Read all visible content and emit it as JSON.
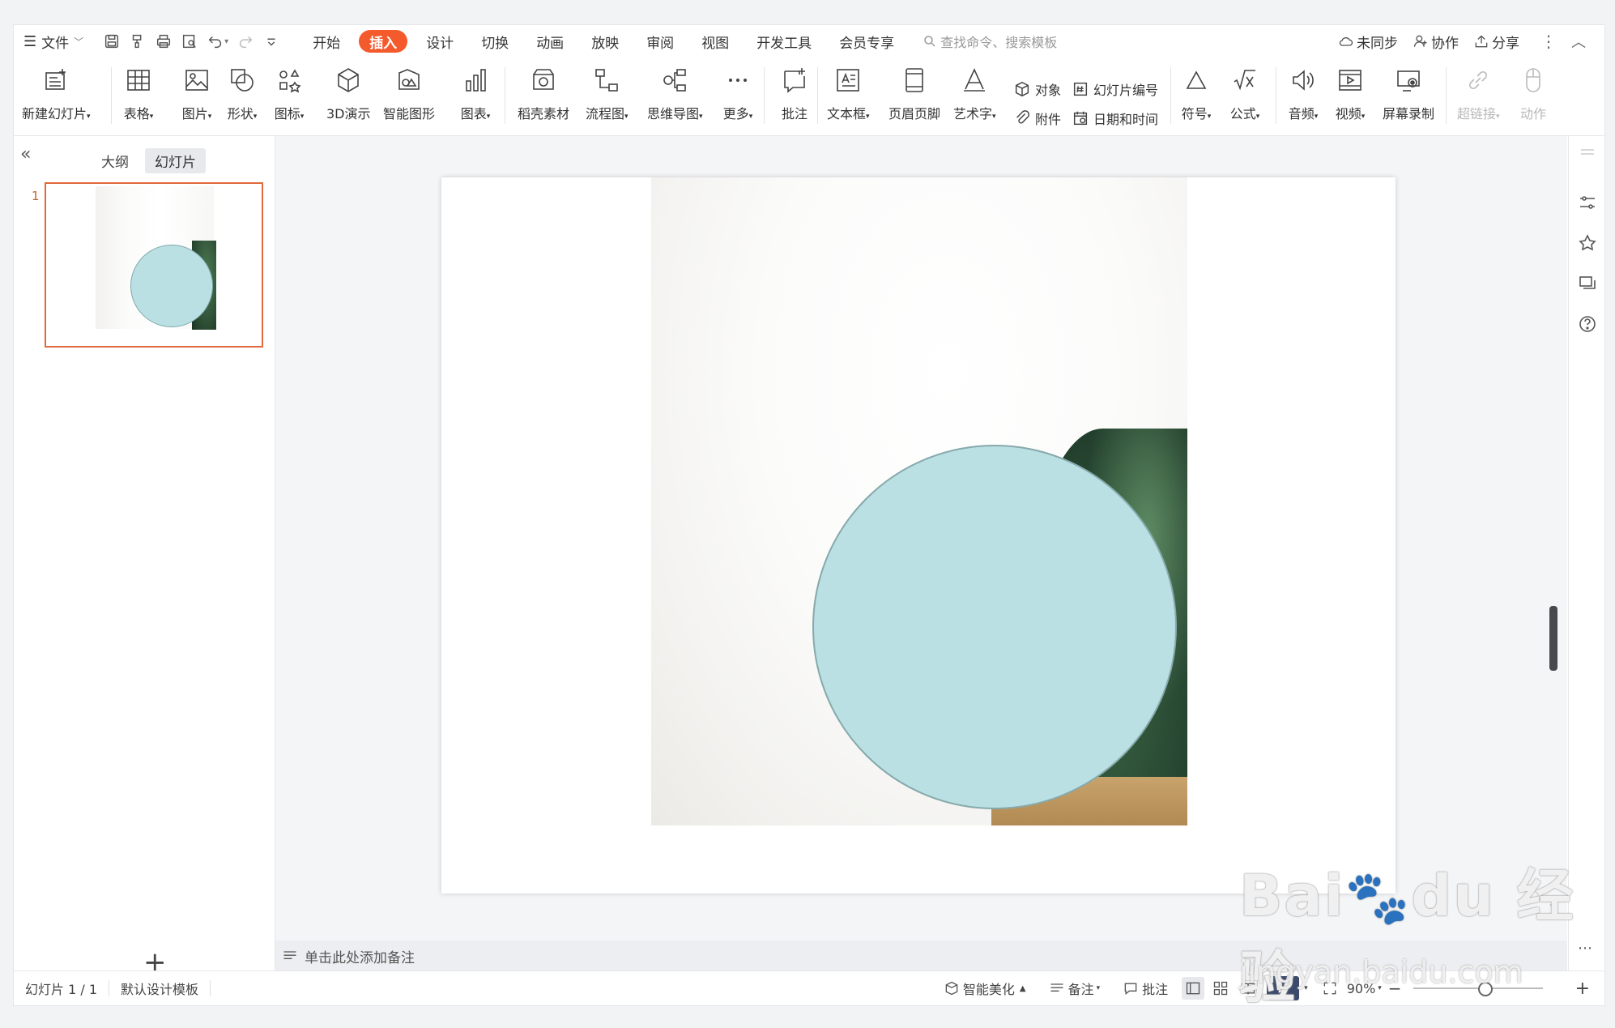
{
  "menu": {
    "file_label": "文件",
    "tabs": [
      "开始",
      "插入",
      "设计",
      "切换",
      "动画",
      "放映",
      "审阅",
      "视图",
      "开发工具",
      "会员专享"
    ],
    "active_tab": "插入",
    "search_placeholder": "查找命令、搜索模板",
    "sync_label": "未同步",
    "collab_label": "协作",
    "share_label": "分享"
  },
  "ribbon": {
    "new_slide": "新建幻灯片",
    "table": "表格",
    "picture": "图片",
    "shape": "形状",
    "icon": "图标",
    "demo3d": "3D演示",
    "smartart": "智能图形",
    "chart": "图表",
    "docer": "稻壳素材",
    "flowchart": "流程图",
    "mindmap": "思维导图",
    "more": "更多",
    "comment": "批注",
    "textbox": "文本框",
    "header_footer": "页眉页脚",
    "wordart": "艺术字",
    "object": "对象",
    "attachment": "附件",
    "slide_number": "幻灯片编号",
    "date_time": "日期和时间",
    "symbol": "符号",
    "formula": "公式",
    "audio": "音频",
    "video": "视频",
    "screen_record": "屏幕录制",
    "hyperlink": "超链接",
    "action": "动作"
  },
  "left_panel": {
    "tab_outline": "大纲",
    "tab_slides": "幻灯片",
    "slide_number": "1",
    "collapse_glyph": "«"
  },
  "notes": {
    "placeholder": "单击此处添加备注"
  },
  "status": {
    "slide_counter": "幻灯片 1 / 1",
    "template": "默认设计模板",
    "beautify": "智能美化",
    "notes": "备注",
    "comment": "批注",
    "zoom": "90%"
  },
  "colors": {
    "accent": "#f55a2c",
    "circle_fill": "#bbe0e3",
    "circle_border": "#86a9ab",
    "thumb_border": "#e06a3a"
  }
}
